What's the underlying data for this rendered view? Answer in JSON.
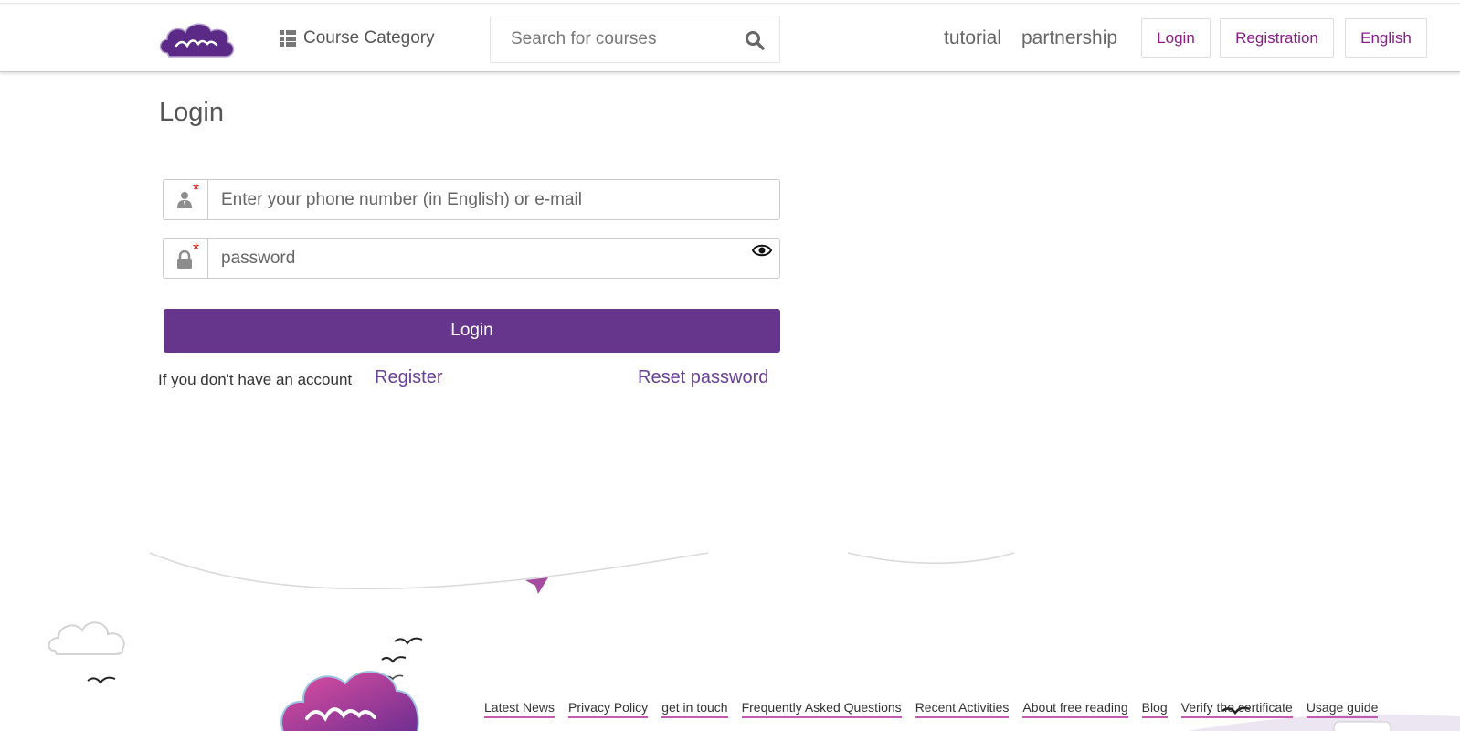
{
  "header": {
    "logo_alt": "মুক্তপাঠ",
    "course_category": "Course Category",
    "search_placeholder": "Search for courses",
    "nav": {
      "tutorial": "tutorial",
      "partnership": "partnership",
      "login": "Login",
      "registration": "Registration",
      "language": "English"
    }
  },
  "form": {
    "title": "Login",
    "username_placeholder": "Enter your phone number (in English) or e-mail",
    "password_placeholder": "password",
    "required_mark": "*",
    "submit": "Login",
    "no_account_text": "If you don't have an account",
    "register_link": "Register",
    "reset_link": "Reset password"
  },
  "footer": {
    "links": [
      "Latest News",
      "Privacy Policy",
      "get in touch",
      "Frequently Asked Questions",
      "Recent Activities",
      "About free reading",
      "Blog",
      "Verify the certificate",
      "Usage guide"
    ]
  },
  "colors": {
    "brand_purple": "#66368c",
    "link_magenta": "#8a1c8a",
    "required_red": "#e00000"
  },
  "icons": [
    "grid-icon",
    "search-icon",
    "user-icon",
    "lock-icon",
    "eye-icon",
    "cloud-icon",
    "bird-icon",
    "paper-plane-icon"
  ]
}
